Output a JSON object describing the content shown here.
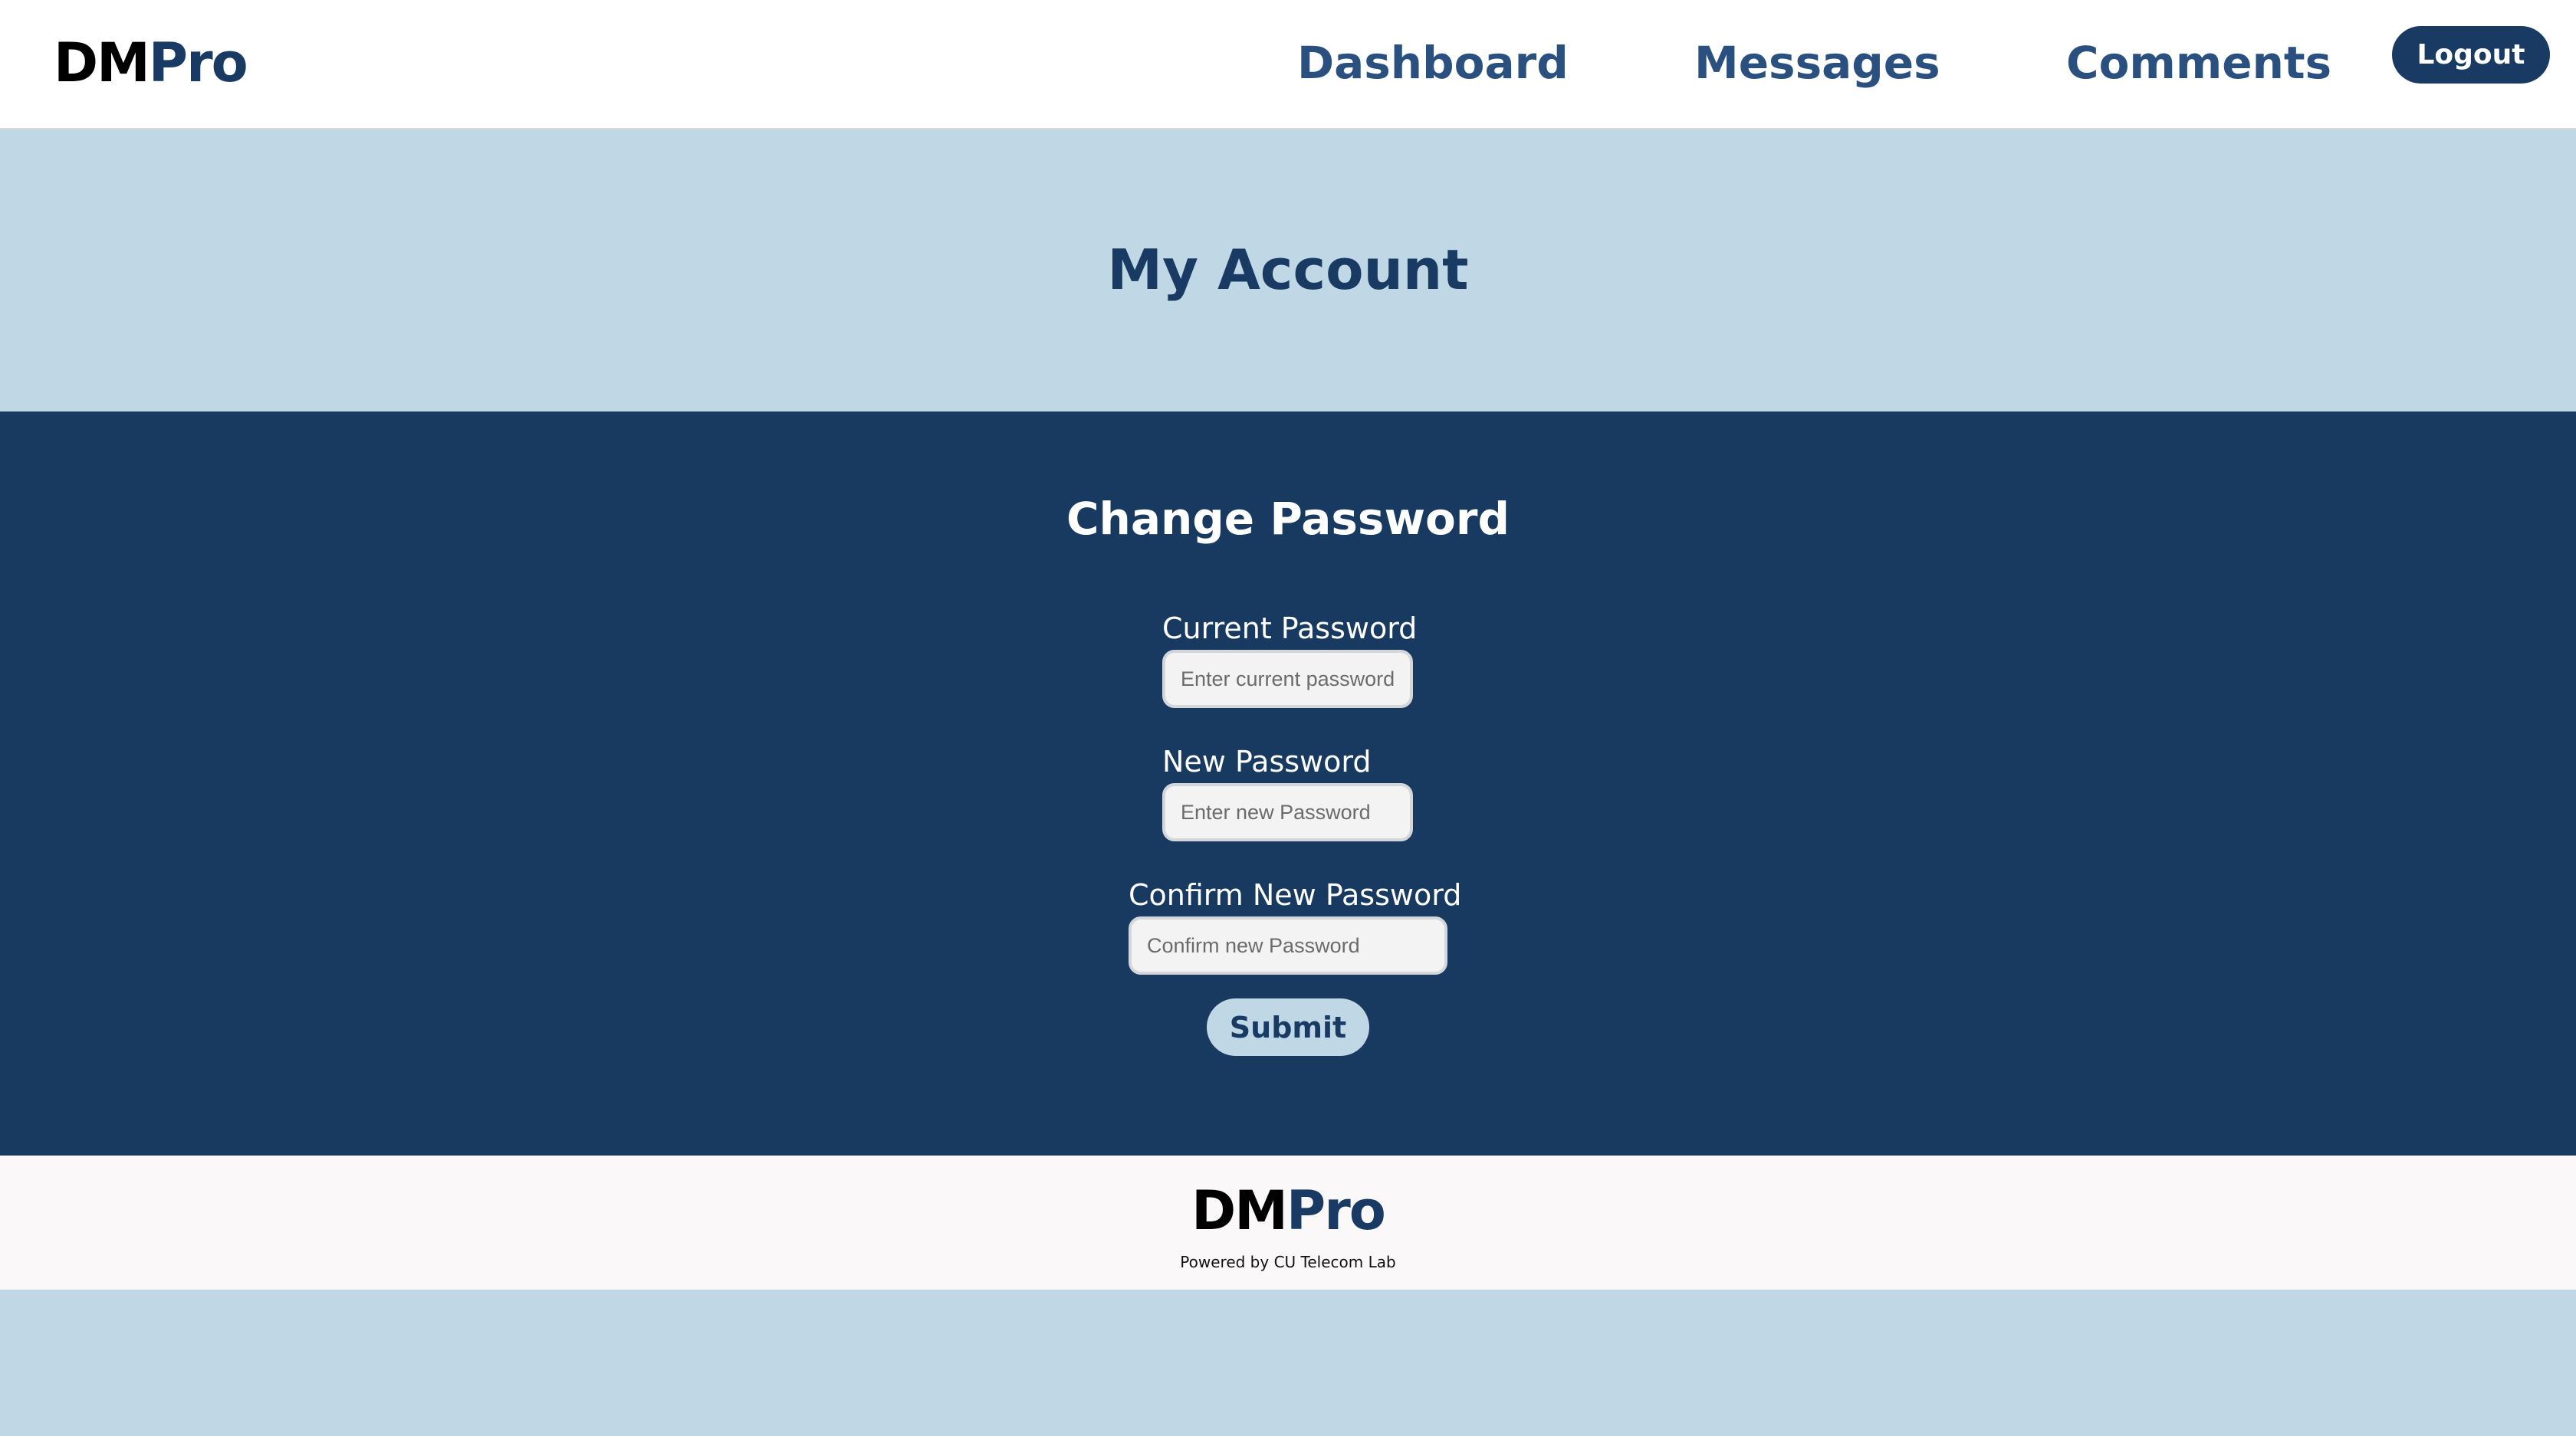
{
  "header": {
    "brand_part1": "DM",
    "brand_part2": "Pro",
    "nav": {
      "dashboard": "Dashboard",
      "messages": "Messages",
      "comments": "Comments"
    },
    "logout_label": "Logout"
  },
  "hero": {
    "title": "My Account"
  },
  "change_password": {
    "title": "Change Password",
    "current": {
      "label": "Current Password",
      "placeholder": "Enter current password"
    },
    "new": {
      "label": "New Password",
      "placeholder": "Enter new Password"
    },
    "confirm": {
      "label": "Confirm New Password",
      "placeholder": "Confirm new Password"
    },
    "submit_label": "Submit"
  },
  "footer": {
    "brand_part1": "DM",
    "brand_part2": "Pro",
    "note": "Powered by CU Telecom Lab"
  },
  "colors": {
    "primary_navy": "#183a63",
    "light_blue": "#c0d8e6",
    "link_blue": "#2a5080"
  }
}
